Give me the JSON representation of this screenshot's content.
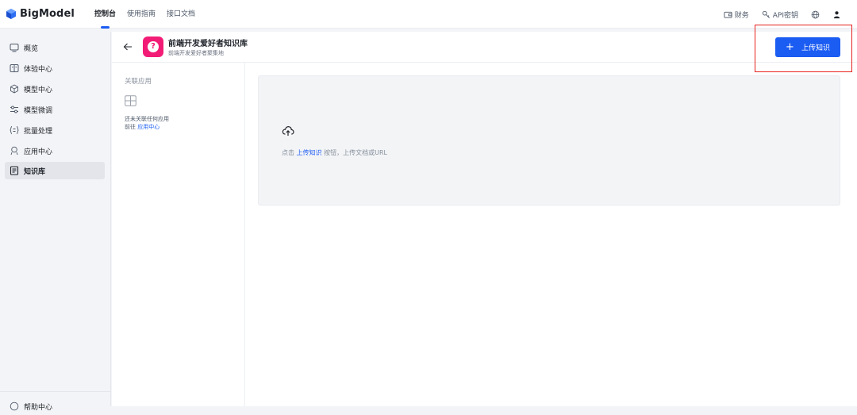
{
  "app": {
    "logo_text": "BigModel",
    "accent": "#1b5cf2",
    "highlight": "#e5231e"
  },
  "topnav": [
    {
      "label": "控制台",
      "active": true
    },
    {
      "label": "使用指南",
      "active": false
    },
    {
      "label": "接口文档",
      "active": false
    }
  ],
  "topright": {
    "finance": "财务",
    "api_key": "API密钥",
    "globe_icon": "globe-icon",
    "user_icon": "user-icon"
  },
  "sidebar": {
    "items": [
      {
        "label": "概览",
        "icon": "monitor-icon"
      },
      {
        "label": "体验中心",
        "icon": "book-icon"
      },
      {
        "label": "模型中心",
        "icon": "cube-icon"
      },
      {
        "label": "模型微调",
        "icon": "tune-icon"
      },
      {
        "label": "批量处理",
        "icon": "brackets-icon"
      },
      {
        "label": "应用中心",
        "icon": "robot-icon"
      },
      {
        "label": "知识库",
        "icon": "document-icon",
        "active": true
      }
    ],
    "help": "帮助中心"
  },
  "header": {
    "title": "前端开发爱好者知识库",
    "subtitle": "前端开发爱好者聚集地",
    "avatar_glyph": "?",
    "upload_plus": "+",
    "upload_label": "上传知识"
  },
  "assoc": {
    "title": "关联应用",
    "empty_text": "还未关联任何应用",
    "goto_prefix": "前往",
    "goto_link": "应用中心"
  },
  "dropzone": {
    "prefix": "点击",
    "link": "上传知识",
    "suffix": "按钮，上传文档或URL"
  }
}
